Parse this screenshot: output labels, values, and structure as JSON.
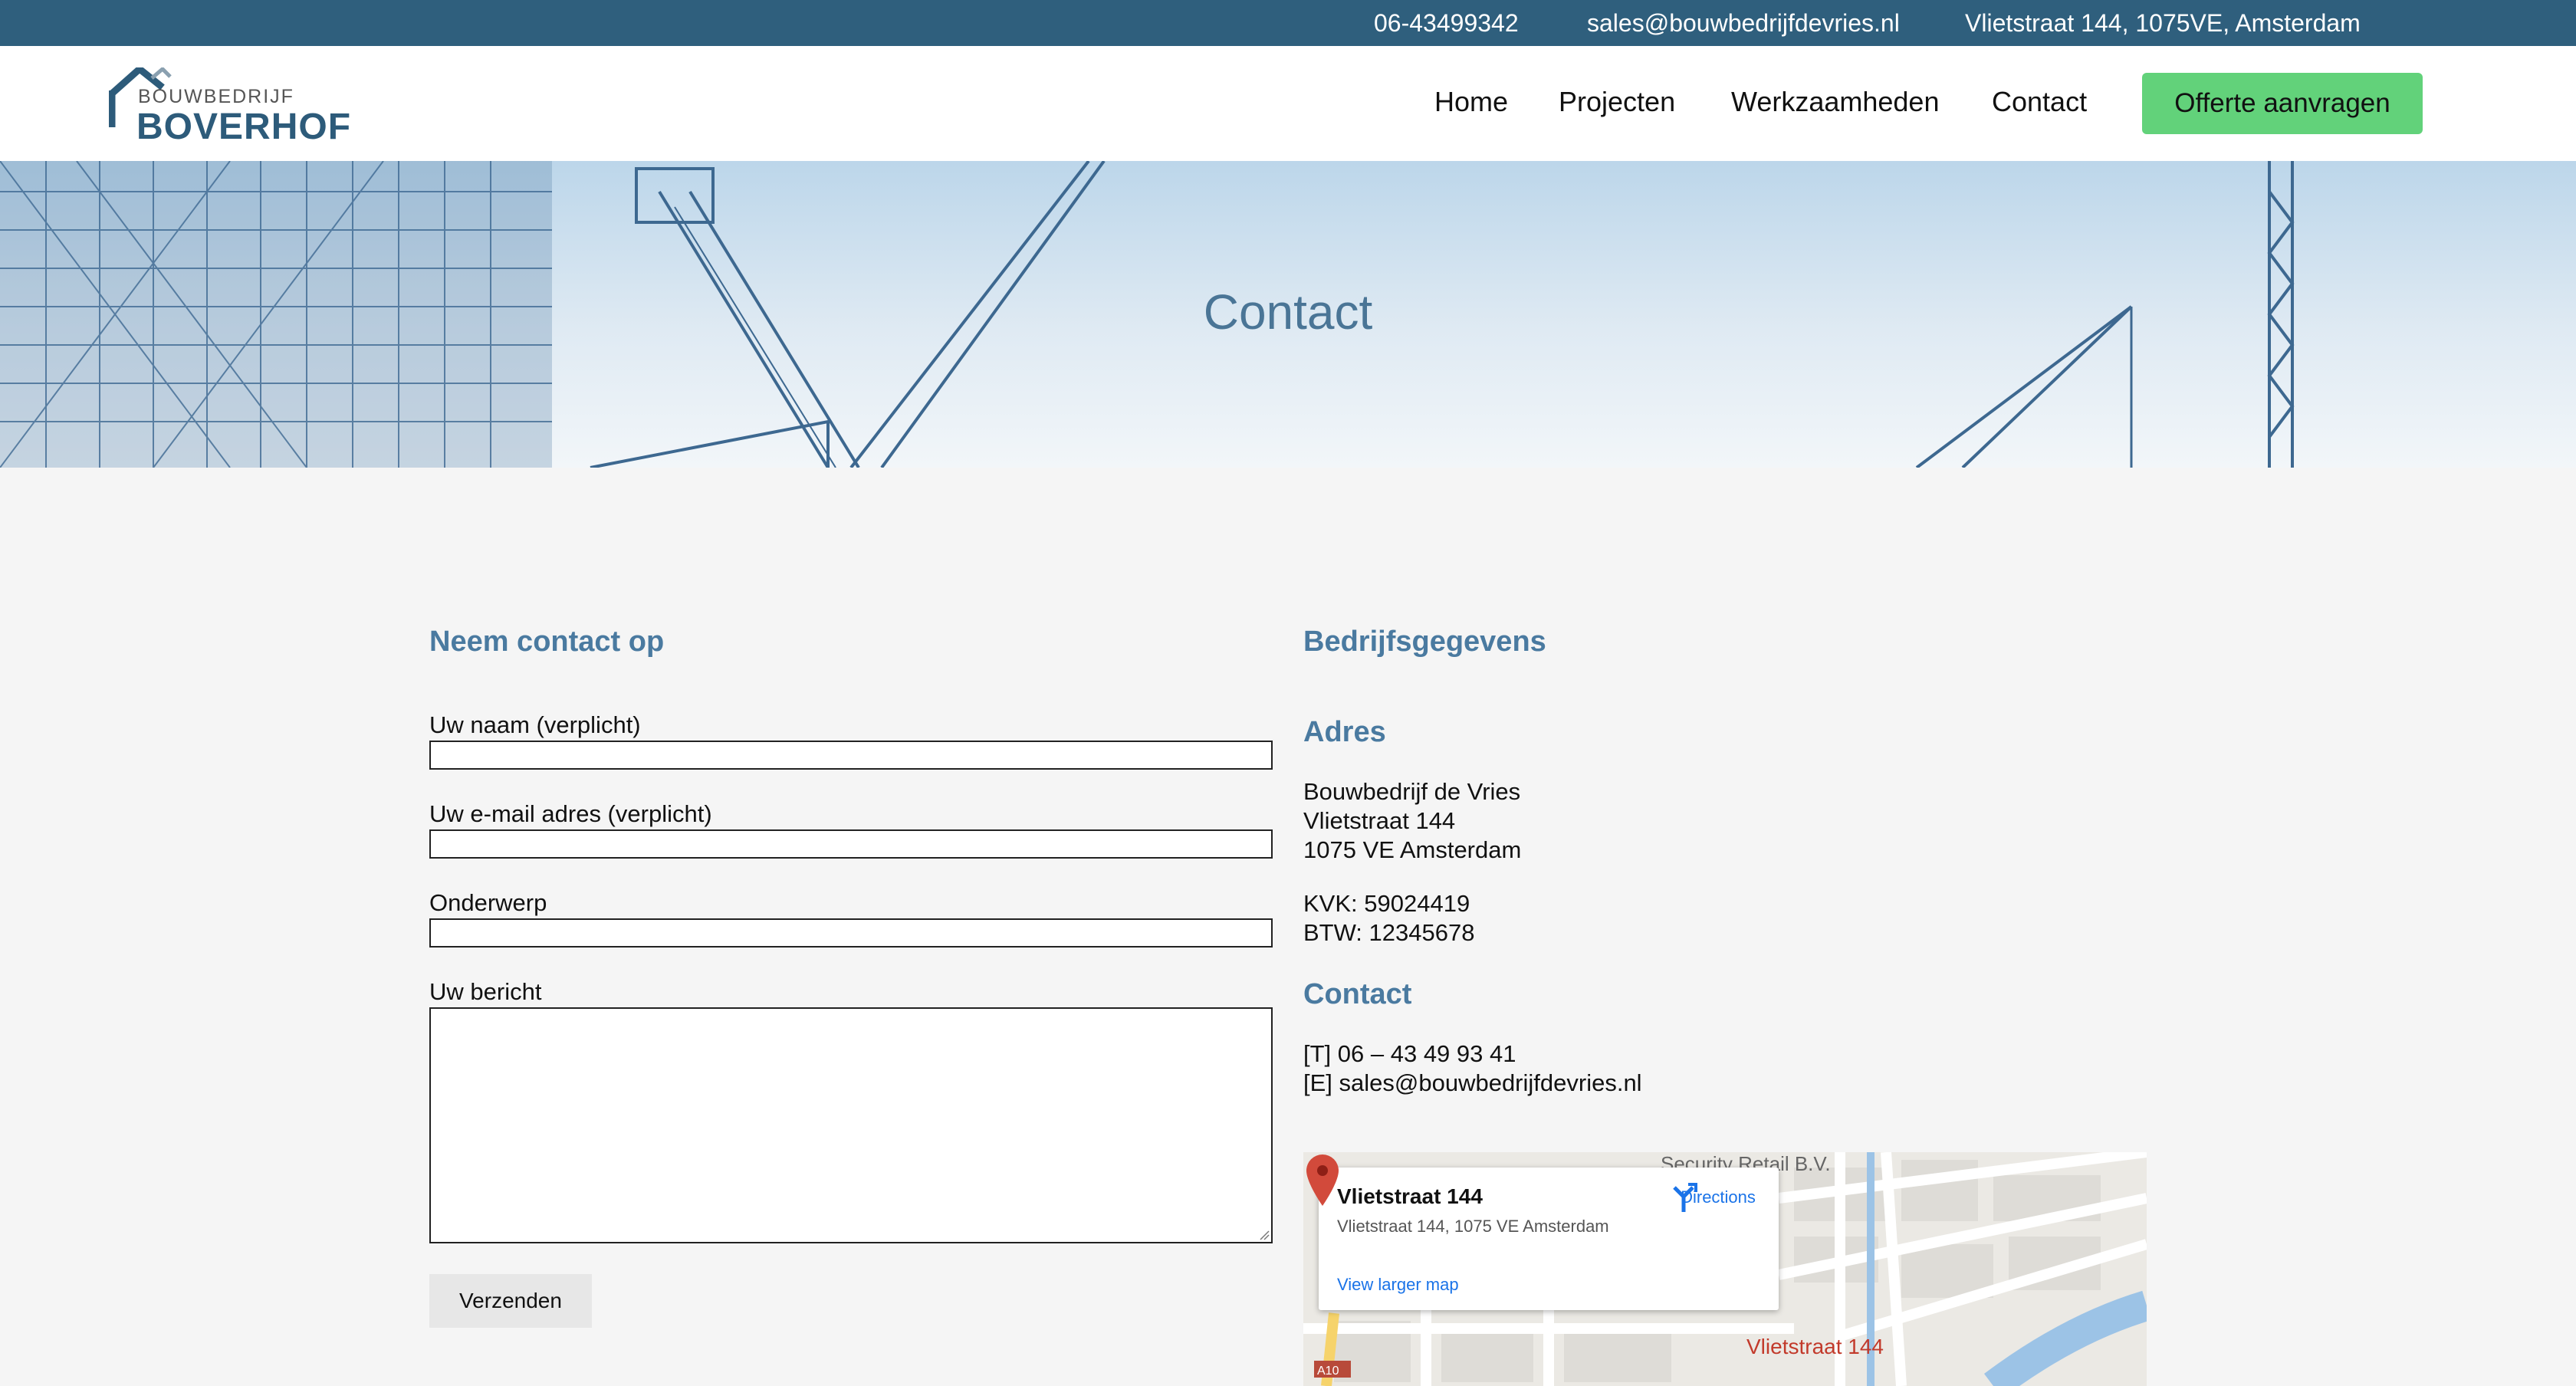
{
  "topbar": {
    "phone": "06-43499342",
    "email": "sales@bouwbedrijfdevries.nl",
    "address": "Vlietstraat 144, 1075VE, Amsterdam"
  },
  "header": {
    "logo_small": "BOUWBEDRIJF",
    "logo_big": "BOVERHOF",
    "nav": [
      "Home",
      "Projecten",
      "Werkzaamheden",
      "Contact"
    ],
    "cta": "Offerte aanvragen"
  },
  "hero": {
    "title": "Contact"
  },
  "form": {
    "heading": "Neem contact op",
    "name_label": "Uw naam (verplicht)",
    "email_label": "Uw e-mail adres (verplicht)",
    "subject_label": "Onderwerp",
    "message_label": "Uw bericht",
    "submit": "Verzenden"
  },
  "company": {
    "heading": "Bedrijfsgegevens",
    "address_heading": "Adres",
    "address_lines": [
      "Bouwbedrijf de Vries",
      "Vlietstraat 144",
      "1075 VE Amsterdam"
    ],
    "kvk": "KVK: 59024419",
    "btw": "BTW: 12345678",
    "contact_heading": "Contact",
    "phone": "[T] 06 – 43 49 93 41",
    "email": "[E] sales@bouwbedrijfdevries.nl"
  },
  "map": {
    "card_title": "Vlietstraat 144",
    "card_address": "Vlietstraat 144, 1075 VE Amsterdam",
    "directions": "Directions",
    "larger_map": "View larger map",
    "pin_label": "Vlietstraat 144",
    "top_label": "Security Retail B.V.",
    "colors": {
      "pin": "#c23a2b",
      "link": "#1a73e8",
      "water": "#9cc3e6",
      "road": "#ffffff"
    }
  },
  "colors": {
    "topbar": "#2f5f7d",
    "heading": "#4a7aa0",
    "cta": "#62d27a",
    "background": "#f5f5f5"
  }
}
